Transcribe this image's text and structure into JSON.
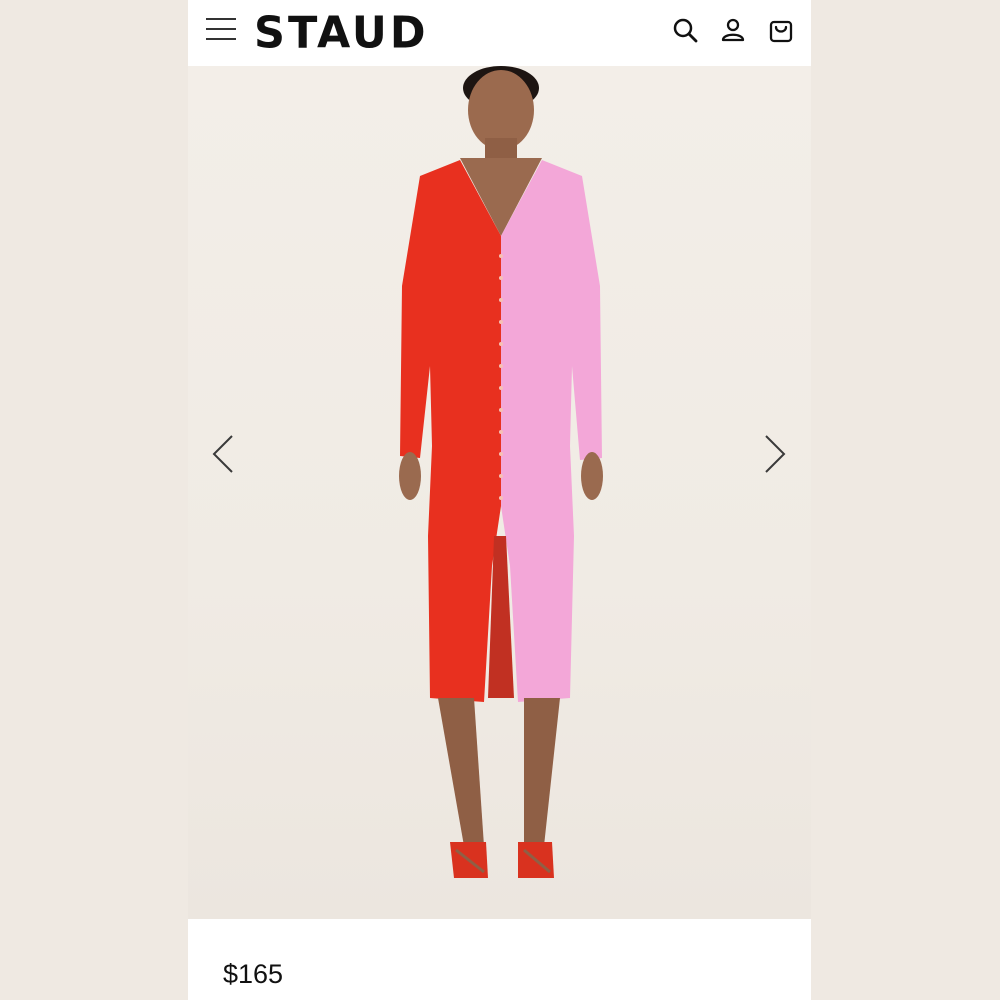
{
  "header": {
    "brand": "STAUD",
    "icons": [
      "hamburger-menu-icon",
      "search-icon",
      "account-icon",
      "shopping-bag-icon"
    ]
  },
  "gallery": {
    "icons": [
      "chevron-left-icon",
      "chevron-right-icon"
    ],
    "colors": {
      "left_panel": "#e8301f",
      "right_panel": "#f3a7d8",
      "backdrop": "#f1ece6"
    }
  },
  "product": {
    "price": "$165"
  }
}
